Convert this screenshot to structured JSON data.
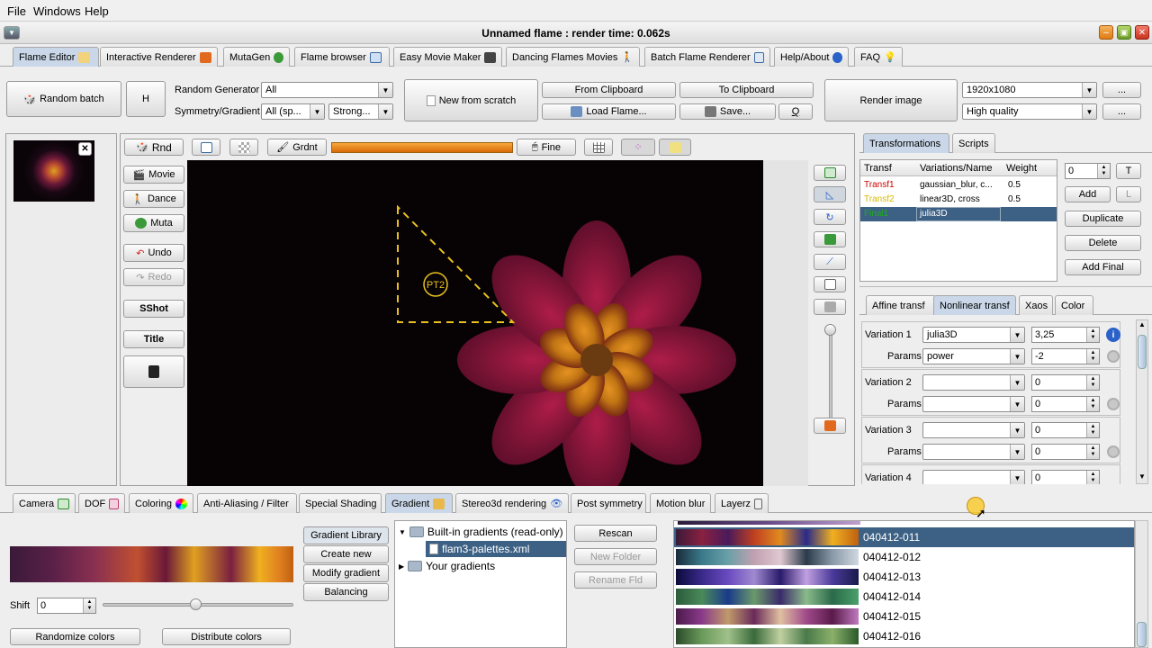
{
  "menu": {
    "file": "File",
    "windows": "Windows",
    "help": "Help"
  },
  "window": {
    "title": "Unnamed flame : render time: 0.062s"
  },
  "main_tabs": [
    "Flame Editor",
    "Interactive Renderer",
    "MutaGen",
    "Flame browser",
    "Easy Movie Maker",
    "Dancing Flames Movies",
    "Batch Flame Renderer",
    "Help/About",
    "FAQ"
  ],
  "toolbar": {
    "random_batch": "Random batch",
    "h": "H",
    "random_generator_label": "Random Generator",
    "random_generator_value": "All",
    "symmetry_label": "Symmetry/Gradient",
    "symmetry_value": "All (sp...",
    "strength_value": "Strong...",
    "new_from_scratch": "New from scratch",
    "from_clipboard": "From Clipboard",
    "to_clipboard": "To Clipboard",
    "load_flame": "Load Flame...",
    "save": "Save...",
    "q": "Q",
    "render_image": "Render image",
    "resolution": "1920x1080",
    "quality": "High quality",
    "more": "..."
  },
  "preview_toolbar": {
    "rnd": "Rnd",
    "grdnt": "Grdnt",
    "fine": "Fine"
  },
  "left_buttons": {
    "movie": "Movie",
    "dance": "Dance",
    "muta": "Muta",
    "undo": "Undo",
    "redo": "Redo",
    "sshot": "SShot",
    "title": "Title"
  },
  "canvas": {
    "triangle_label": "PT2"
  },
  "right_tabs": [
    "Transformations",
    "Scripts"
  ],
  "transforms_table": {
    "headers": [
      "Transf",
      "Variations/Name",
      "Weight"
    ],
    "rows": [
      {
        "name": "Transf1",
        "variations": "gaussian_blur, c...",
        "weight": "0.5",
        "color": "#d00000"
      },
      {
        "name": "Transf2",
        "variations": "linear3D, cross",
        "weight": "0.5",
        "color": "#d8b800"
      },
      {
        "name": "Final1",
        "variations": "julia3D",
        "weight": "",
        "color": "#22aa22"
      }
    ]
  },
  "transform_controls": {
    "spinner_value": "0",
    "t": "T",
    "add": "Add",
    "l": "L",
    "duplicate": "Duplicate",
    "delete": "Delete",
    "add_final": "Add Final"
  },
  "sub_tabs": [
    "Affine transf",
    "Nonlinear transf",
    "Xaos",
    "Color"
  ],
  "variations": [
    {
      "label": "Variation 1",
      "name": "julia3D",
      "value": "3,25",
      "params_label": "Params",
      "param": "power",
      "param_value": "-2"
    },
    {
      "label": "Variation 2",
      "name": "",
      "value": "0",
      "params_label": "Params",
      "param": "",
      "param_value": "0"
    },
    {
      "label": "Variation 3",
      "name": "",
      "value": "0",
      "params_label": "Params",
      "param": "",
      "param_value": "0"
    },
    {
      "label": "Variation 4",
      "name": "",
      "value": "0"
    }
  ],
  "bottom_tabs": [
    "Camera",
    "DOF",
    "Coloring",
    "Anti-Aliasing / Filter",
    "Special Shading",
    "Gradient",
    "Stereo3d rendering",
    "Post symmetry",
    "Motion blur",
    "Layerz"
  ],
  "gradient": {
    "shift_label": "Shift",
    "shift_value": "0",
    "shift_level": 0.5,
    "randomize": "Randomize colors",
    "distribute": "Distribute colors",
    "side_buttons": [
      "Gradient Library",
      "Create new",
      "Modify gradient",
      "Balancing"
    ],
    "tree": {
      "builtin": "Built-in gradients (read-only)",
      "file": "flam3-palettes.xml",
      "yours": "Your gradients"
    },
    "rescan": "Rescan",
    "new_folder": "New Folder",
    "rename": "Rename Fld",
    "palettes": [
      "040412-011",
      "040412-012",
      "040412-013",
      "040412-014",
      "040412-015",
      "040412-016"
    ]
  },
  "colors": {
    "selection": "#3d6185",
    "accent": "#f39c12"
  }
}
